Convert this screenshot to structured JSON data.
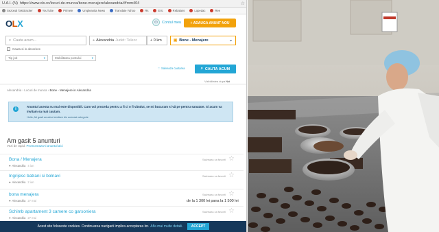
{
  "browser": {
    "url": "https://www.olx.ro/locuri-de-munca/bone-menajere/alexandria/#from404",
    "url_prefix": "U.A.I. (N)",
    "bookmarks": [
      "Sezonal Tasktracker",
      "YouTube",
      "Primele",
      "Umpleanita News",
      "Translate Yahoo",
      "Rs",
      "Eric",
      "Rebalans",
      "Lopedac",
      "Ree"
    ]
  },
  "header": {
    "logo": {
      "o": "O",
      "l": "L",
      "x": "X"
    },
    "account_label": "Contul meu",
    "add_button": "+ ADAUGA ANUNT NOU"
  },
  "search": {
    "query_placeholder": "Cauta acum...",
    "location_value": "Alexandria",
    "location_hint": "Judet: Teleor",
    "radius": "+ 0 km",
    "category": "Bone - Menajere",
    "only_with_desc_label": "Cauta si in descriere",
    "filter_type": "Tip job",
    "filter_mobility": "Mobilitatea postului",
    "save_search": "Salveaza cautarea",
    "search_button": "CAUTA ACUM",
    "sort_label": "Vizibilitatea dupa",
    "sort_value": "Noi"
  },
  "breadcrumbs": [
    "Alexandria",
    "Locuri de munca",
    "Bone - Menajere in Alexandria"
  ],
  "notice": {
    "text": "Anuntul acesta nu mai este disponibil. Cum voi proceda pentru a fi ci o fi vândut, se mi bucuram si vă pe pentru sanatate. Si acum va invitam sa mai cautam.",
    "sub": "Hello, Ati gasit anunturi similare din aceeasi categorie"
  },
  "results": {
    "heading": "Am gasit 5 anunturi",
    "sub_prefix": "Vezi de rapid.",
    "sub_link": "Promoveaza-ti anuntul aici"
  },
  "ads": [
    {
      "title": "Bona / Menajera",
      "location": "Alexandria",
      "time": "4 iun",
      "fav": "Salveaza ca favorit",
      "price": "",
      "price_value": ""
    },
    {
      "title": "Ingrijesc batrani si bolnavi",
      "location": "Alexandria",
      "time": "2 iun",
      "fav": "Salveaza ca favorit",
      "price": "",
      "price_value": ""
    },
    {
      "title": "bona menajera",
      "location": "Alexandria",
      "time": "27 mai",
      "fav": "Salveaza ca favorit",
      "price": "de la 1 300 lei",
      "price_value": "pana la 1 500 lei"
    },
    {
      "title": "Schimb apartament 3 camere co garsoniera",
      "location": "Alexandria",
      "time": "27 mai",
      "fav": "Salveaza ca favorit",
      "price": "",
      "price_value": ""
    }
  ],
  "cookie": {
    "text": "Acest site foloseste cookies. Continuarea navigarii implica acceptarea lor.",
    "link": "Afla mai multe detalii.",
    "accept": "ACCEPT"
  },
  "colors": {
    "olx_navy": "#16385a",
    "olx_orange": "#f2a20c",
    "olx_blue": "#23a6d5"
  }
}
